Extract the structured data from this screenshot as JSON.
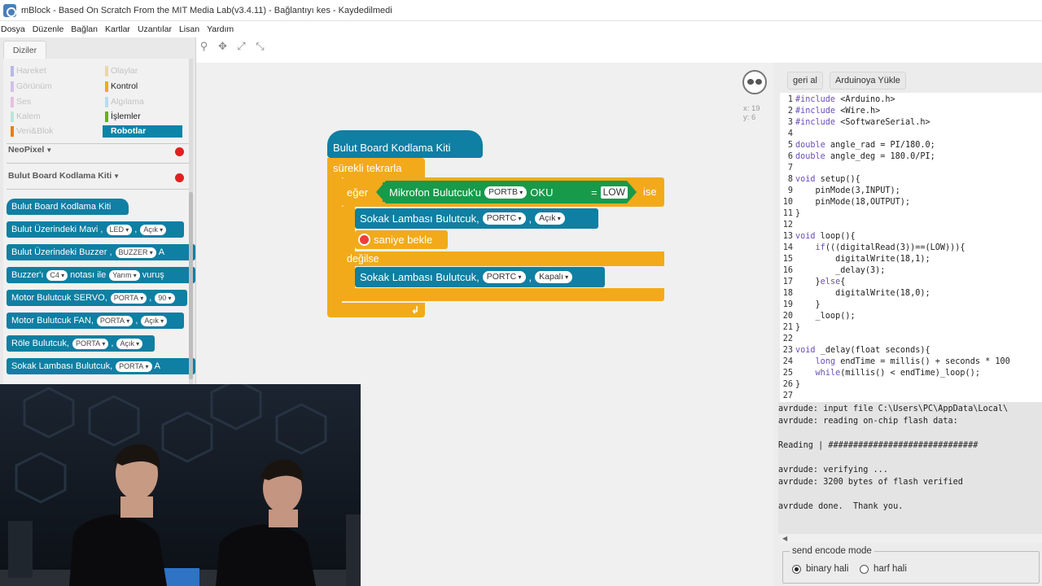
{
  "window": {
    "title": "mBlock - Based On Scratch From the MIT Media Lab(v3.4.11) - Bağlantıyı kes - Kaydedilmedi"
  },
  "menu": [
    "Dosya",
    "Düzenle",
    "Bağlan",
    "Kartlar",
    "Uzantılar",
    "Lisan",
    "Yardım"
  ],
  "palette": {
    "tab": "Diziler",
    "categories": [
      {
        "label": "Hareket",
        "color": "#b7b9e6",
        "dim": true
      },
      {
        "label": "Olaylar",
        "color": "#e8d7a8",
        "dim": true
      },
      {
        "label": "Görünüm",
        "color": "#d3c0ea",
        "dim": true
      },
      {
        "label": "Kontrol",
        "color": "#f2aa1b",
        "dim": false
      },
      {
        "label": "Ses",
        "color": "#e6c1df",
        "dim": true
      },
      {
        "label": "Algılama",
        "color": "#b6dcee",
        "dim": true
      },
      {
        "label": "Kalem",
        "color": "#bfe4d6",
        "dim": true
      },
      {
        "label": "İşlemler",
        "color": "#5cb712",
        "dim": false
      },
      {
        "label": "Veri&Blok",
        "color": "#ee7d16",
        "dim": true
      },
      {
        "label": "Robotlar",
        "color": "#0d84a8",
        "dim": false,
        "selected": true
      }
    ],
    "sections": [
      "NeoPixel",
      "Bulut Board Kodlama Kiti"
    ],
    "blocks": [
      {
        "text": "Bulut Board Kodlama Kiti",
        "hat": true
      },
      {
        "text": "Bulut Üzerindeki Mavi ,",
        "pills": [
          "LED",
          "Açık"
        ]
      },
      {
        "text": "Bulut Üzerindeki Buzzer ,",
        "pills": [
          "BUZZER"
        ],
        "tail": "A"
      },
      {
        "text": "Buzzer'ı",
        "pills": [
          "C4"
        ],
        "mid": "notası ile",
        "pills2": [
          "Yarım"
        ],
        "tail": "vuruş"
      },
      {
        "text": "Motor Bulutcuk SERVO,",
        "pills": [
          "PORTA",
          "90"
        ]
      },
      {
        "text": "Motor Bulutcuk FAN,",
        "pills": [
          "PORTA",
          "Açık"
        ]
      },
      {
        "text": "Röle Bulutcuk,",
        "pills": [
          "PORTA",
          "Açık"
        ]
      },
      {
        "text": "Sokak Lambası Bulutcuk,",
        "pills": [
          "PORTA"
        ],
        "tail": "A"
      }
    ]
  },
  "stage": {
    "coords": {
      "x": "x: 19",
      "y": "y: 6"
    }
  },
  "script": {
    "hat": "Bulut  Board  Kodlama  Kiti",
    "forever": "sürekli  tekrarla",
    "if_label": "eğer",
    "condition": {
      "text": "Mikrofon  Bulutcuk'u",
      "port": "PORTB",
      "read": "OKU",
      "eq": "=",
      "value": "LOW"
    },
    "then_label": "ise",
    "cmd1": {
      "text": "Sokak Lambası Bulutcuk,",
      "port": "PORTC",
      "state": "Açık"
    },
    "wait": {
      "text": "saniye  bekle"
    },
    "else_label": "değilse",
    "cmd3": {
      "text": "Sokak Lambası Bulutcuk,",
      "port": "PORTC",
      "state": "Kapalı"
    }
  },
  "right": {
    "undo_button": "geri al",
    "upload_button": "Arduinoya Yükle",
    "code_lines": [
      "#include <Arduino.h>",
      "#include <Wire.h>",
      "#include <SoftwareSerial.h>",
      "",
      "double angle_rad = PI/180.0;",
      "double angle_deg = 180.0/PI;",
      "",
      "void setup(){",
      "    pinMode(3,INPUT);",
      "    pinMode(18,OUTPUT);",
      "}",
      "",
      "void loop(){",
      "    if(((digitalRead(3))==(LOW))){",
      "        digitalWrite(18,1);",
      "        _delay(3);",
      "    }else{",
      "        digitalWrite(18,0);",
      "    }",
      "    _loop();",
      "}",
      "",
      "void _delay(float seconds){",
      "    long endTime = millis() + seconds * 100",
      "    while(millis() < endTime)_loop();",
      "}",
      ""
    ],
    "console_lines": [
      "avrdude: input file C:\\Users\\PC\\AppData\\Local\\",
      "avrdude: reading on-chip flash data:",
      "",
      "Reading | ##############################",
      "",
      "avrdude: verifying ...",
      "avrdude: 3200 bytes of flash verified",
      "",
      "avrdude done.  Thank you."
    ],
    "encode": {
      "title": "send encode mode",
      "options": [
        "binary hali",
        "harf hali"
      ],
      "selected": 0
    }
  }
}
